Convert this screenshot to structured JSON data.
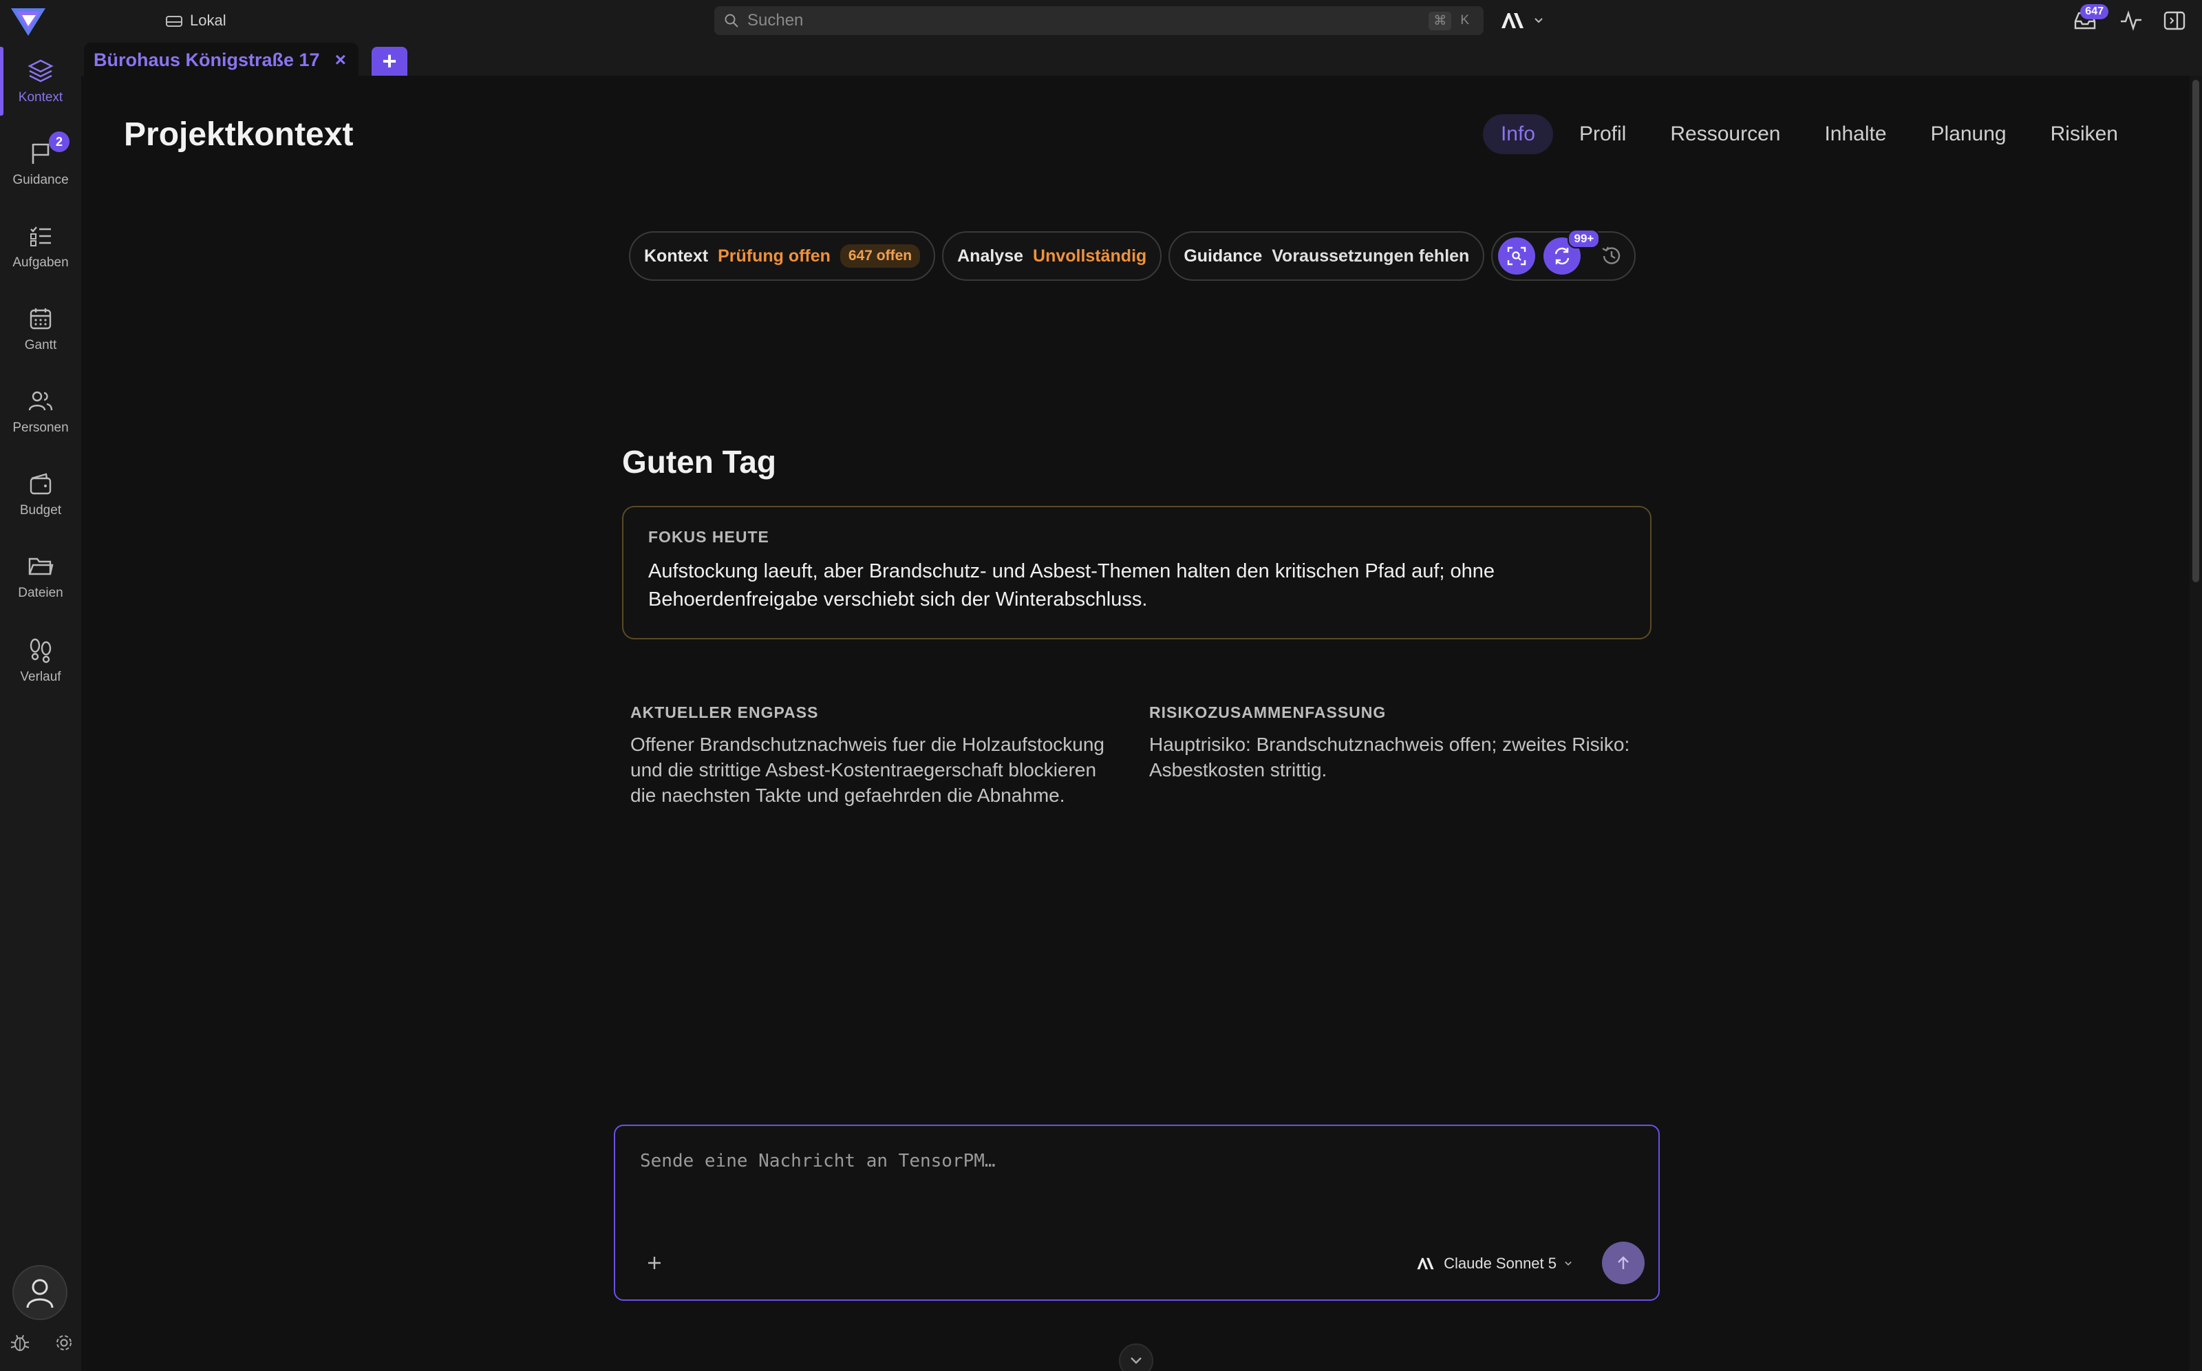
{
  "topbar": {
    "workspace_label": "Lokal",
    "search": {
      "placeholder": "Suchen",
      "shortcut_key1": "⌘",
      "shortcut_key2": "K"
    },
    "inbox_count": "647"
  },
  "sidebar": {
    "items": [
      {
        "id": "kontext",
        "label": "Kontext",
        "icon": "layers-icon",
        "active": true
      },
      {
        "id": "guidance",
        "label": "Guidance",
        "icon": "flag-icon",
        "badge": "2"
      },
      {
        "id": "aufgaben",
        "label": "Aufgaben",
        "icon": "checklist-icon"
      },
      {
        "id": "gantt",
        "label": "Gantt",
        "icon": "calendar-icon"
      },
      {
        "id": "personen",
        "label": "Personen",
        "icon": "users-icon"
      },
      {
        "id": "budget",
        "label": "Budget",
        "icon": "wallet-icon"
      },
      {
        "id": "dateien",
        "label": "Dateien",
        "icon": "folder-icon"
      },
      {
        "id": "verlauf",
        "label": "Verlauf",
        "icon": "footprints-icon"
      }
    ]
  },
  "tabstrip": {
    "active_tab": "Bürohaus Königstraße 17",
    "close_glyph": "×",
    "add_glyph": "+"
  },
  "page": {
    "title": "Projektkontext",
    "tabs": [
      "Info",
      "Profil",
      "Ressourcen",
      "Inhalte",
      "Planung",
      "Risiken"
    ],
    "active_tab": "Info"
  },
  "status": {
    "kontext": {
      "key": "Kontext",
      "value": "Prüfung offen",
      "count": "647 offen"
    },
    "analyse": {
      "key": "Analyse",
      "value": "Unvollständig"
    },
    "guidance": {
      "key": "Guidance",
      "value": "Voraussetzungen fehlen"
    },
    "badge": "99+"
  },
  "content": {
    "greeting": "Guten Tag",
    "focus": {
      "label": "FOKUS HEUTE",
      "text": "Aufstockung laeuft, aber Brandschutz- und Asbest-Themen halten den kritischen Pfad auf; ohne Behoerdenfreigabe verschiebt sich der Winterabschluss."
    },
    "engpass": {
      "label": "AKTUELLER ENGPASS",
      "text": "Offener Brandschutznachweis fuer die Holzaufstockung und die strittige Asbest-Kostentraegerschaft blockieren die naechsten Takte und gefaehrden die Abnahme."
    },
    "risiko": {
      "label": "RISIKOZUSAMMENFASSUNG",
      "text": "Hauptrisiko: Brandschutznachweis offen; zweites Risiko: Asbestkosten strittig."
    }
  },
  "composer": {
    "placeholder": "Sende eine Nachricht an TensorPM…",
    "model": "Claude Sonnet 5"
  },
  "colors": {
    "accent": "#6d4fe8",
    "accent_text": "#8b74f0",
    "warning": "#f0913a",
    "background": "#111111",
    "panel": "#1a1a1a"
  }
}
